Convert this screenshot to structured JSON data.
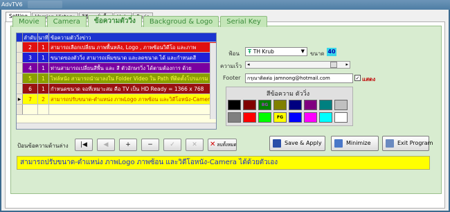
{
  "window": {
    "title": "AdvTV6"
  },
  "outer_tabs": [
    "Setting",
    "Version History",
    "วิธีการสั่งซื้อ",
    "Help",
    "ติดต่อ"
  ],
  "inner_tabs": [
    "Movie",
    "Camera",
    "ข้อความตัววิ่ง",
    "Backgroud & Logo",
    "Serial Key"
  ],
  "grid": {
    "headers": [
      "ลำดับ",
      "นาที",
      "ข้อความตัววิ่งข่าว"
    ],
    "rows": [
      {
        "no": "2",
        "min": "1",
        "text": "สามารถเลือกเปลี่ยน ภาพพื้นหลัง, Logo , ภาพซ้อนวิดีโอ และภาพ",
        "bg": "#e01010",
        "fg": "#ffffff"
      },
      {
        "no": "3",
        "min": "1",
        "text": "ขนาดของตัววิ่ง สามารถเพิ่มขนาด และลดขนาด ได้ และกำหนดสี",
        "bg": "#2020d8",
        "fg": "#ffffff"
      },
      {
        "no": "4",
        "min": "1",
        "text": "ท่านสามารถเปลี่ยนสีพื้น และ สี ตัวอักษรวิ่ง ได้ตามต้องการ ด้วย",
        "bg": "#7a00a0",
        "fg": "#ffffff"
      },
      {
        "no": "5",
        "min": "1",
        "text": "ไฟล์หนัง สามารถนำมาลงใน Folder Video ใน Path ที่ติดตั้งโปรแกรม",
        "bg": "#8aa000",
        "fg": "#ffff40"
      },
      {
        "no": "6",
        "min": "1",
        "text": "กำหนดขนาด จอที่เหมาะสม คือ TV เป็น HD Ready = 1366 x 768",
        "bg": "#9a1010",
        "fg": "#ffffff"
      },
      {
        "no": "7",
        "min": "2",
        "text": "สามารถปรับขนาด-ตำแหน่ง ภาพLogo ภาพซ้อน และวิดีโอหนัง-Camera",
        "bg": "#ffff00",
        "fg": "#c04000"
      }
    ]
  },
  "font": {
    "label": "ฟ้อน",
    "value": "TH Krub",
    "size_label": "ขนาด",
    "size_value": "40"
  },
  "speed": {
    "label": "ความเร็ว",
    "value": 0.85
  },
  "footer": {
    "label": "Footer",
    "value": "กรุณาติดต่อ jamnong@hotmail.com",
    "show_label": "แสดง",
    "checked": true
  },
  "colors": {
    "title": "สีข้อความ ตัววิ่ง",
    "swatches": [
      {
        "color": "#000000",
        "text": ""
      },
      {
        "color": "#800000",
        "text": ""
      },
      {
        "color": "#008000",
        "text": "BG"
      },
      {
        "color": "#808000",
        "text": ""
      },
      {
        "color": "#000080",
        "text": ""
      },
      {
        "color": "#800080",
        "text": ""
      },
      {
        "color": "#008080",
        "text": ""
      },
      {
        "color": "#c0c0c0",
        "text": ""
      },
      {
        "color": "#808080",
        "text": ""
      },
      {
        "color": "#ff0000",
        "text": ""
      },
      {
        "color": "#00ff00",
        "text": ""
      },
      {
        "color": "#ffff00",
        "text": "FG"
      },
      {
        "color": "#0000ff",
        "text": ""
      },
      {
        "color": "#ff00ff",
        "text": ""
      },
      {
        "color": "#00ffff",
        "text": ""
      },
      {
        "color": "#ffffff",
        "text": ""
      }
    ]
  },
  "nav": {
    "label": "ป้อนข้อความด้านล่าง",
    "buttons": [
      "|◀",
      "◀",
      "+",
      "−",
      "✓",
      "✕"
    ],
    "delete_label": "ลบทั้งหมด"
  },
  "actions": {
    "save": "Save & Apply",
    "minimize": "Minimize",
    "exit": "Exit Program"
  },
  "ticker": "สามารถปรับขนาด-ตำแหน่ง ภาพLogo ภาพซ้อน และวิดีโอหนัง-Camera ได้ด้วยตัวเอง"
}
